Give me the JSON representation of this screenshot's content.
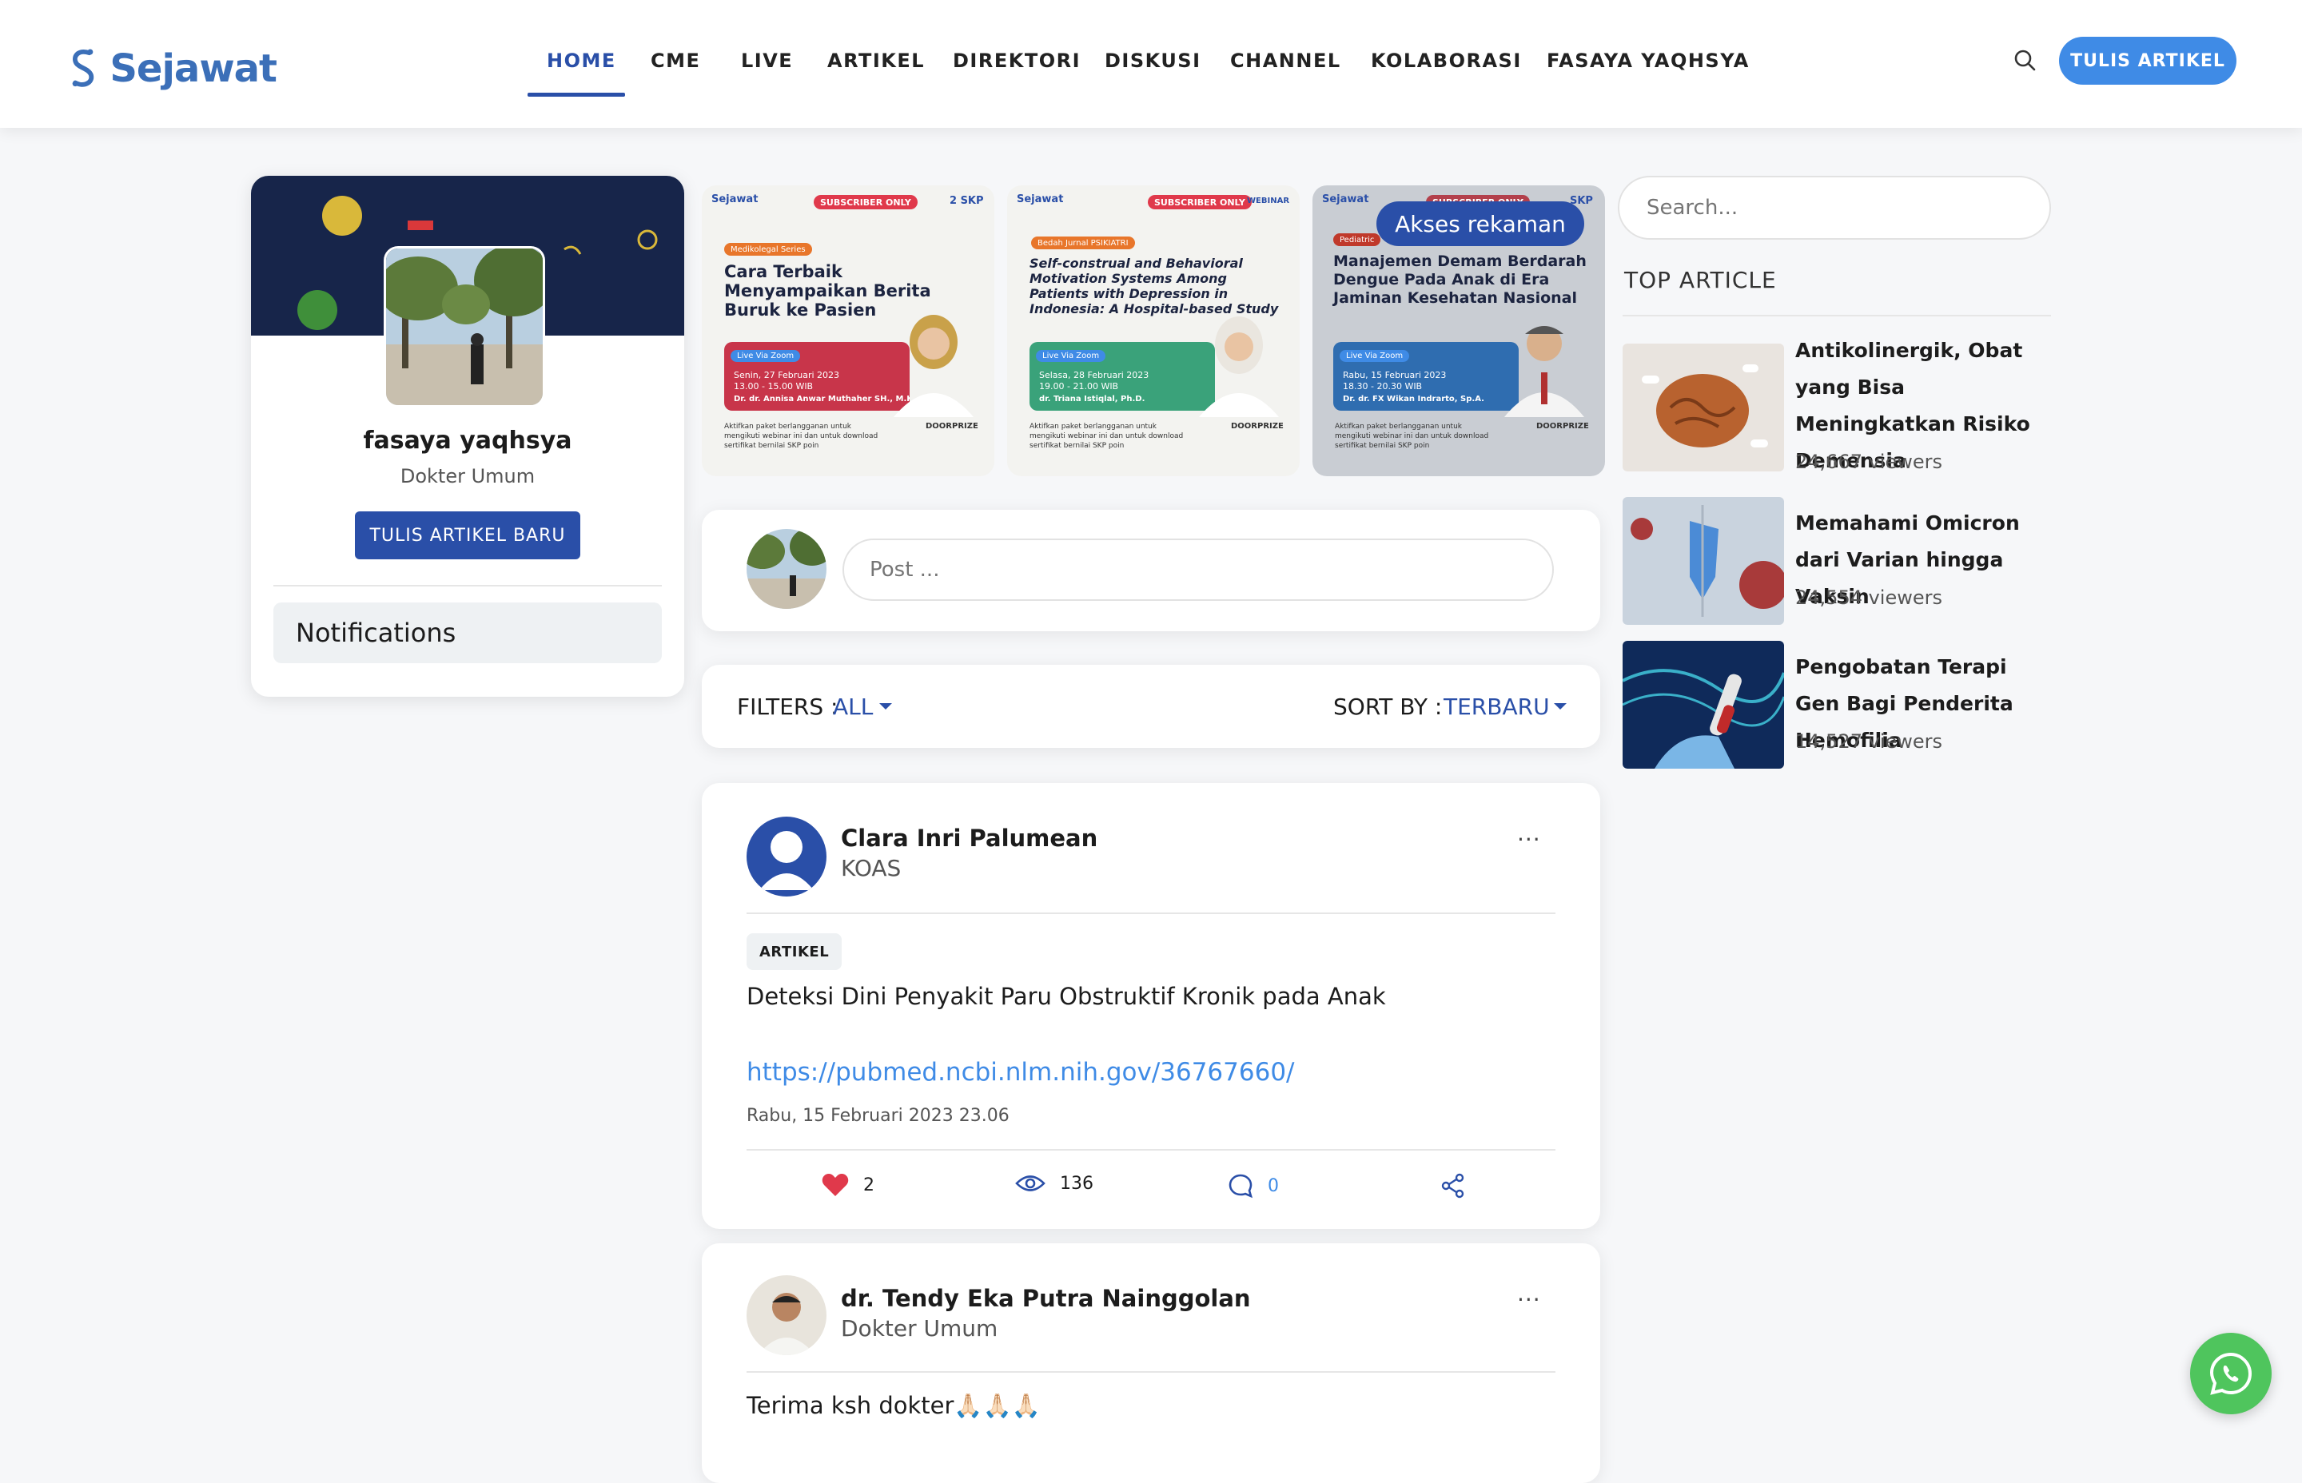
{
  "brand": {
    "name": "Sejawat",
    "color": "#3b6fb8"
  },
  "nav": {
    "items": [
      "HOME",
      "CME",
      "LIVE",
      "ARTIKEL",
      "DIREKTORI",
      "DISKUSI",
      "CHANNEL",
      "KOLABORASI",
      "FASAYA YAQHSYA"
    ],
    "active": "HOME",
    "write_button": "TULIS ARTIKEL"
  },
  "profile": {
    "name": "fasaya yaqhsya",
    "role": "Dokter Umum",
    "write_button": "TULIS ARTIKEL BARU",
    "notifications": "Notifications"
  },
  "banners": [
    {
      "brand": "Sejawat",
      "badge": "SUBSCRIBER ONLY",
      "skp": "2 SKP",
      "series": "Medikolegal Series",
      "title": "Cara Terbaik Menyampaikan Berita Buruk ke Pasien",
      "live": "Live Via Zoom",
      "date": "Senin, 27 Februari 2023",
      "time": "13.00 - 15.00 WIB",
      "speaker": "Dr. dr. Annisa Anwar Muthaher SH., M.Kes., Sp.F",
      "footer": "Aktifkan paket berlangganan untuk mengikuti webinar ini dan untuk download sertifikat bernilai SKP poin",
      "doorprize": "DOORPRIZE"
    },
    {
      "brand": "Sejawat",
      "badge": "SUBSCRIBER ONLY",
      "skp": "WEBINAR",
      "series": "Bedah Jurnal PSIKIATRI",
      "title": "Self-construal and Behavioral Motivation Systems Among Patients with Depression in Indonesia: A Hospital-based Study",
      "live": "Live Via Zoom",
      "date": "Selasa, 28 Februari 2023",
      "time": "19.00 - 21.00 WIB",
      "speaker": "dr. Triana Istiqlal, Ph.D.",
      "footer": "Aktifkan paket berlangganan untuk mengikuti webinar ini dan untuk download sertifikat bernilai SKP poin",
      "doorprize": "DOORPRIZE"
    },
    {
      "brand": "Sejawat",
      "badge": "SUBSCRIBER ONLY",
      "skp": "SKP",
      "series": "Pediatric",
      "title": "Manajemen Demam Berdarah Dengue Pada Anak di Era Jaminan Kesehatan Nasional",
      "live": "Live Via Zoom",
      "date": "Rabu, 15 Februari 2023",
      "time": "18.30 - 20.30 WIB",
      "speaker": "Dr. dr. FX Wikan Indrarto, Sp.A.",
      "footer": "Aktifkan paket berlangganan untuk mengikuti webinar ini dan untuk download sertifikat bernilai SKP poin",
      "doorprize": "DOORPRIZE",
      "overlay": "Akses rekaman"
    }
  ],
  "composer": {
    "placeholder": "Post ..."
  },
  "filters": {
    "filter_label": "FILTERS :",
    "filter_value": "ALL",
    "sort_label": "SORT BY :",
    "sort_value": "TERBARU"
  },
  "posts": [
    {
      "author": "Clara Inri Palumean",
      "role": "KOAS",
      "more": "...",
      "tag": "ARTIKEL",
      "title": "Deteksi Dini Penyakit Paru Obstruktif Kronik pada Anak",
      "link": "https://pubmed.ncbi.nlm.nih.gov/36767660/",
      "timestamp": "Rabu, 15 Februari 2023 23.06",
      "likes": "2",
      "views": "136",
      "comments": "0"
    },
    {
      "author": "dr. Tendy Eka Putra Nainggolan",
      "role": "Dokter Umum",
      "more": "...",
      "text": "Terima ksh dokter🙏🏻🙏🏻🙏🏻"
    }
  ],
  "sidebar": {
    "search_placeholder": "Search...",
    "top_title": "TOP ARTICLE",
    "articles": [
      {
        "title": "Antikolinergik, Obat yang Bisa Meningkatkan Risiko Demensia",
        "views": "24,667 viewers"
      },
      {
        "title": "Memahami Omicron dari Varian hingga Vaksin",
        "views": "24,554 viewers"
      },
      {
        "title": "Pengobatan Terapi Gen Bagi Penderita Hemofilia",
        "views": "14,527 viewers"
      }
    ]
  },
  "colors": {
    "primary": "#2a4fa8",
    "accent": "#3f8be6",
    "like": "#e0394b",
    "whatsapp": "#4fc55d"
  }
}
